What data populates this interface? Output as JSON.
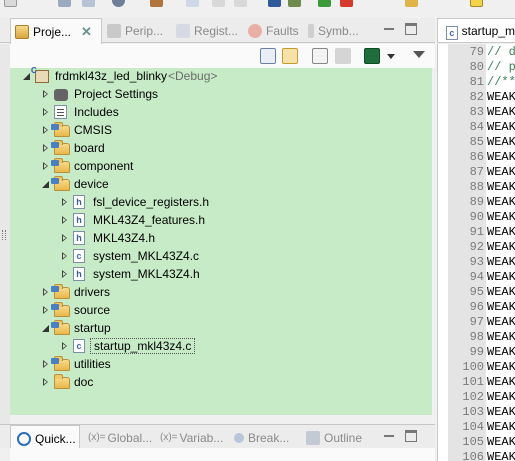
{
  "toolbar": {
    "icons": [
      "new-file-icon",
      "save-icon",
      "save-all-icon",
      "debug-config-icon",
      "build-hammer-icon",
      "register-0101-icon",
      "nav-back-icon",
      "nav-forward-icon",
      "debug-icon",
      "settings-icon",
      "run-icon",
      "stop-icon",
      "open-folder-icon",
      "edit-icon"
    ]
  },
  "view_tabs": [
    {
      "label": "Proje...",
      "icon": "project-explorer-icon",
      "active": true
    },
    {
      "label": "Perip...",
      "icon": "peripherals-icon",
      "active": false
    },
    {
      "label": "Regist...",
      "icon": "registers-icon",
      "active": false
    },
    {
      "label": "Faults",
      "icon": "faults-bug-icon",
      "active": false
    },
    {
      "label": "Symb...",
      "icon": "symbols-icon",
      "active": false
    }
  ],
  "view_close_glyph": "✕",
  "tree": [
    {
      "label": "frdmkl43z_led_blinky",
      "suffix": "<Debug>",
      "kind": "project",
      "level": 0,
      "state": "expanded"
    },
    {
      "label": "Project Settings",
      "kind": "settings",
      "level": 1,
      "state": "collapsed"
    },
    {
      "label": "Includes",
      "kind": "includes",
      "level": 1,
      "state": "collapsed"
    },
    {
      "label": "CMSIS",
      "kind": "src-folder",
      "level": 1,
      "state": "collapsed"
    },
    {
      "label": "board",
      "kind": "src-folder",
      "level": 1,
      "state": "collapsed"
    },
    {
      "label": "component",
      "kind": "src-folder",
      "level": 1,
      "state": "collapsed"
    },
    {
      "label": "device",
      "kind": "src-folder",
      "level": 1,
      "state": "expanded"
    },
    {
      "label": "fsl_device_registers.h",
      "kind": "h-file",
      "level": 2,
      "state": "collapsed"
    },
    {
      "label": "MKL43Z4_features.h",
      "kind": "h-file",
      "level": 2,
      "state": "collapsed"
    },
    {
      "label": "MKL43Z4.h",
      "kind": "h-file",
      "level": 2,
      "state": "collapsed"
    },
    {
      "label": "system_MKL43Z4.c",
      "kind": "c-file",
      "level": 2,
      "state": "collapsed"
    },
    {
      "label": "system_MKL43Z4.h",
      "kind": "h-file",
      "level": 2,
      "state": "collapsed"
    },
    {
      "label": "drivers",
      "kind": "src-folder",
      "level": 1,
      "state": "collapsed"
    },
    {
      "label": "source",
      "kind": "src-folder",
      "level": 1,
      "state": "collapsed"
    },
    {
      "label": "startup",
      "kind": "src-folder",
      "level": 1,
      "state": "expanded"
    },
    {
      "label": "startup_mkl43z4.c",
      "kind": "c-file",
      "level": 2,
      "state": "collapsed",
      "selected": true
    },
    {
      "label": "utilities",
      "kind": "src-folder",
      "level": 1,
      "state": "collapsed"
    },
    {
      "label": "doc",
      "kind": "folder",
      "level": 1,
      "state": "collapsed"
    }
  ],
  "editor": {
    "tab_label": "startup_m",
    "lines": [
      {
        "n": "79",
        "text": "// d",
        "kind": "comment"
      },
      {
        "n": "80",
        "text": "// p",
        "kind": "comment"
      },
      {
        "n": "81",
        "text": "//**",
        "kind": "comment"
      },
      {
        "n": "82",
        "text": "WEAK",
        "kind": "kw"
      },
      {
        "n": "83",
        "text": "WEAK",
        "kind": "kw"
      },
      {
        "n": "84",
        "text": "WEAK",
        "kind": "kw"
      },
      {
        "n": "85",
        "text": "WEAK",
        "kind": "kw"
      },
      {
        "n": "86",
        "text": "WEAK",
        "kind": "kw"
      },
      {
        "n": "87",
        "text": "WEAK",
        "kind": "kw"
      },
      {
        "n": "88",
        "text": "WEAK",
        "kind": "kw"
      },
      {
        "n": "89",
        "text": "WEAK",
        "kind": "kw"
      },
      {
        "n": "90",
        "text": "WEAK",
        "kind": "kw"
      },
      {
        "n": "91",
        "text": "WEAK",
        "kind": "kw"
      },
      {
        "n": "92",
        "text": "WEAK",
        "kind": "kw"
      },
      {
        "n": "93",
        "text": "WEAK",
        "kind": "kw"
      },
      {
        "n": "94",
        "text": "WEAK",
        "kind": "kw"
      },
      {
        "n": "95",
        "text": "WEAK",
        "kind": "kw"
      },
      {
        "n": "96",
        "text": "WEAK",
        "kind": "kw"
      },
      {
        "n": "97",
        "text": "WEAK",
        "kind": "kw"
      },
      {
        "n": "98",
        "text": "WEAK",
        "kind": "kw"
      },
      {
        "n": "99",
        "text": "WEAK",
        "kind": "kw"
      },
      {
        "n": "100",
        "text": "WEAK",
        "kind": "kw"
      },
      {
        "n": "101",
        "text": "WEAK",
        "kind": "kw"
      },
      {
        "n": "102",
        "text": "WEAK",
        "kind": "kw"
      },
      {
        "n": "103",
        "text": "WEAK",
        "kind": "kw"
      },
      {
        "n": "104",
        "text": "WEAK",
        "kind": "kw"
      },
      {
        "n": "105",
        "text": "WEAK",
        "kind": "kw"
      },
      {
        "n": "106",
        "text": "WEAK",
        "kind": "kw"
      }
    ]
  },
  "bottom_tabs": [
    {
      "label": "Quick...",
      "icon": "quickstart-power-icon",
      "active": true
    },
    {
      "label": "Global...",
      "prefix": "(x)=",
      "icon": "global-variables-icon",
      "active": false
    },
    {
      "label": "Variab...",
      "prefix": "(x)=",
      "icon": "variables-icon",
      "active": false
    },
    {
      "label": "Break...",
      "icon": "breakpoints-icon",
      "active": false
    },
    {
      "label": "Outline",
      "icon": "outline-icon",
      "active": false
    }
  ],
  "colors": {
    "tree_background": "#c7ebc7",
    "selection": "#c7ebc7",
    "comment": "#3f7f5f",
    "folder": "#e8b74a"
  }
}
